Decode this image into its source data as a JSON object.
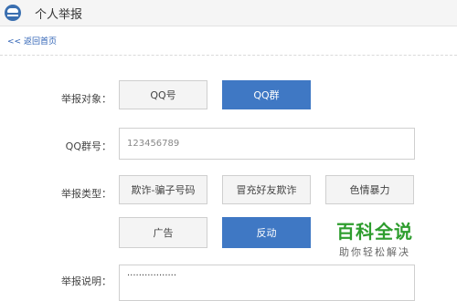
{
  "header": {
    "title": "个人举报",
    "icon": "police-cap-icon"
  },
  "nav": {
    "back_link": "<< 返回首页"
  },
  "form": {
    "target_label": "举报对象：",
    "target_options": [
      "QQ号",
      "QQ群"
    ],
    "target_selected": "QQ群",
    "group_label": "QQ群号：",
    "group_value": "123456789",
    "type_label": "举报类型：",
    "type_options": [
      "欺诈-骗子号码",
      "冒充好友欺诈",
      "色情暴力",
      "广告",
      "反动"
    ],
    "type_selected": "反动",
    "desc_label": "举报说明：",
    "desc_value": "·················"
  },
  "watermark": {
    "main": "百科全说",
    "sub": "助你轻松解决",
    "color": "#2e9d2e"
  },
  "colors": {
    "accent": "#3f78c4",
    "link": "#2e62b5"
  }
}
